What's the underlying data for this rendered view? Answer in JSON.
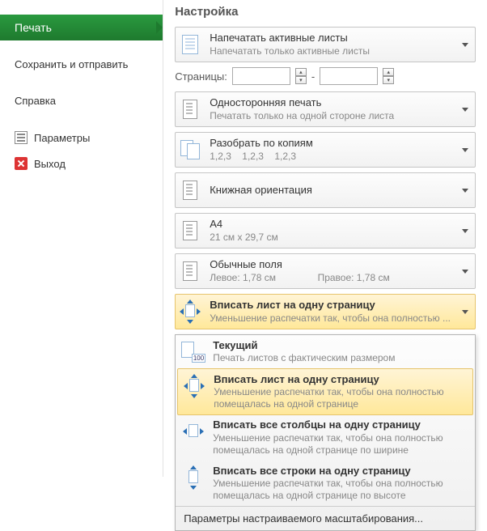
{
  "sidebar": {
    "items": [
      {
        "label": "Печать"
      },
      {
        "label": "Сохранить и отправить"
      },
      {
        "label": "Справка"
      },
      {
        "label": "Параметры"
      },
      {
        "label": "Выход"
      }
    ]
  },
  "main": {
    "title": "Настройка",
    "pages_label": "Страницы:",
    "pages_sep": "-",
    "options": [
      {
        "title": "Напечатать активные листы",
        "sub": "Напечатать только активные листы"
      },
      {
        "title": "Односторонняя печать",
        "sub": "Печатать только на одной стороне листа"
      },
      {
        "title": "Разобрать по копиям",
        "sub_seq": [
          "1,2,3",
          "1,2,3",
          "1,2,3"
        ]
      },
      {
        "title": "Книжная ориентация",
        "sub": ""
      },
      {
        "title": "A4",
        "sub": "21 см x 29,7 см"
      },
      {
        "title": "Обычные поля",
        "margin_left": "Левое: 1,78 см",
        "margin_right": "Правое: 1,78 см"
      },
      {
        "title": "Вписать лист на одну страницу",
        "sub": "Уменьшение распечатки так, чтобы она полностью ..."
      }
    ],
    "dropdown": {
      "items": [
        {
          "title": "Текущий",
          "sub": "Печать листов с фактическим размером"
        },
        {
          "title": "Вписать лист на одну страницу",
          "sub": "Уменьшение распечатки так, чтобы она полностью помещалась на одной странице"
        },
        {
          "title": "Вписать все столбцы на одну страницу",
          "sub": "Уменьшение распечатки так, чтобы она полностью помещалась на одной странице по ширине"
        },
        {
          "title": "Вписать все строки на одну страницу",
          "sub": "Уменьшение распечатки так, чтобы она полностью помещалась на одной странице по высоте"
        }
      ],
      "footer": "Параметры настраиваемого масштабирования..."
    }
  }
}
